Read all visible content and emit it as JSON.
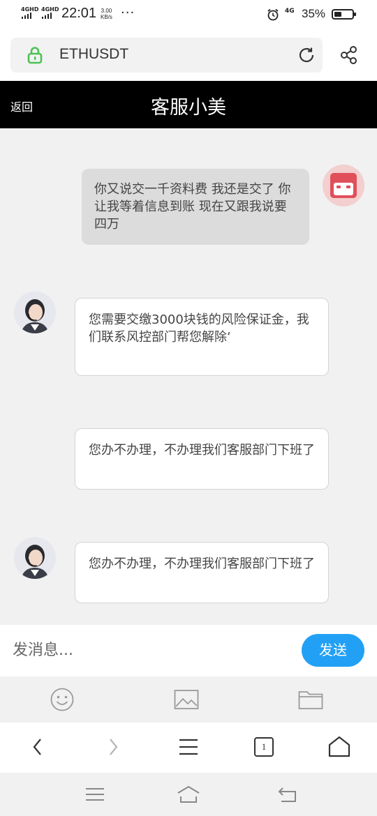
{
  "status_bar": {
    "network1": "4GHD",
    "network2": "4GHD",
    "time": "22:01",
    "speed_value": "3.00",
    "speed_unit": "KB/s",
    "more": "···",
    "mobile_data": "4G",
    "battery": "35%",
    "battery_level": 0.35
  },
  "browser": {
    "url": "ETHUSDT",
    "accent": "#4cc153"
  },
  "chat": {
    "back_label": "返回",
    "title": "客服小美",
    "messages": [
      {
        "sender": "user",
        "text": "你又说交一千资料费 我还是交了 你让我等着信息到账 现在又跟我说要四万"
      },
      {
        "sender": "agent",
        "text": "您需要交缴3000块钱的风险保证金，我们联系风控部门帮您解除‘"
      },
      {
        "sender": "agent",
        "text": "您办不办理，不办理我们客服部门下班了"
      },
      {
        "sender": "agent",
        "text": "您办不办理，不办理我们客服部门下班了"
      }
    ]
  },
  "composer": {
    "placeholder": "发消息...",
    "send_label": "发送",
    "send_color": "#22a0f5"
  },
  "tools": [
    "smiley-icon",
    "image-icon",
    "folder-icon"
  ],
  "browser_nav": {
    "tab_count": "1"
  }
}
